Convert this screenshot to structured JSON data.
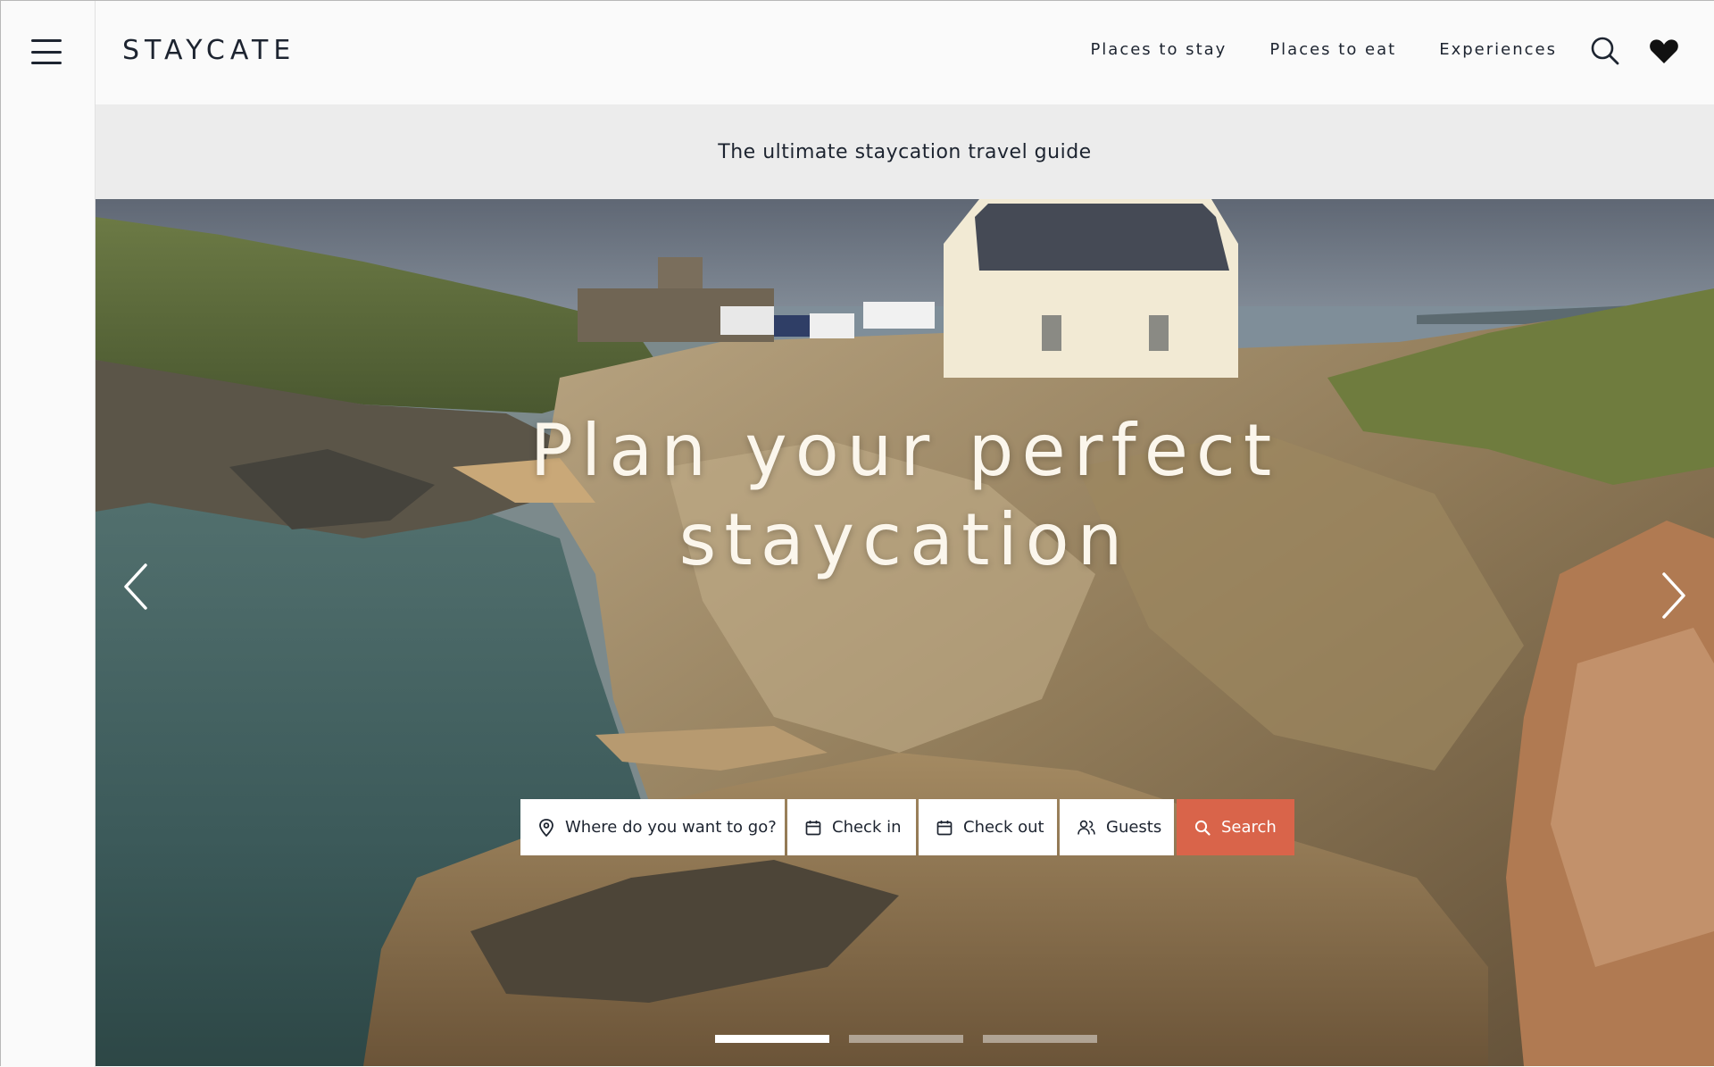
{
  "brand": {
    "logo": "STAYCATE"
  },
  "nav": {
    "items": [
      {
        "label": "Places to stay"
      },
      {
        "label": "Places to eat"
      },
      {
        "label": "Experiences"
      }
    ],
    "search_icon": "search-icon",
    "favorites_icon": "heart-icon",
    "menu_icon": "hamburger-menu-icon"
  },
  "tagline": "The ultimate staycation travel guide",
  "hero": {
    "title_line1": "Plan your perfect",
    "title_line2": "staycation",
    "prev_icon": "chevron-left-icon",
    "next_icon": "chevron-right-icon",
    "slides": {
      "count": 3,
      "active_index": 0
    }
  },
  "search": {
    "where": {
      "label": "Where do you want to go?",
      "icon": "location-pin-icon"
    },
    "check_in": {
      "label": "Check in",
      "icon": "calendar-icon"
    },
    "check_out": {
      "label": "Check out",
      "icon": "calendar-icon"
    },
    "guests": {
      "label": "Guests",
      "icon": "users-icon"
    },
    "submit": {
      "label": "Search",
      "icon": "search-icon"
    }
  },
  "colors": {
    "accent": "#d9644a",
    "text": "#1d2430",
    "strip_bg": "#ececec",
    "header_bg": "#fafafa"
  }
}
